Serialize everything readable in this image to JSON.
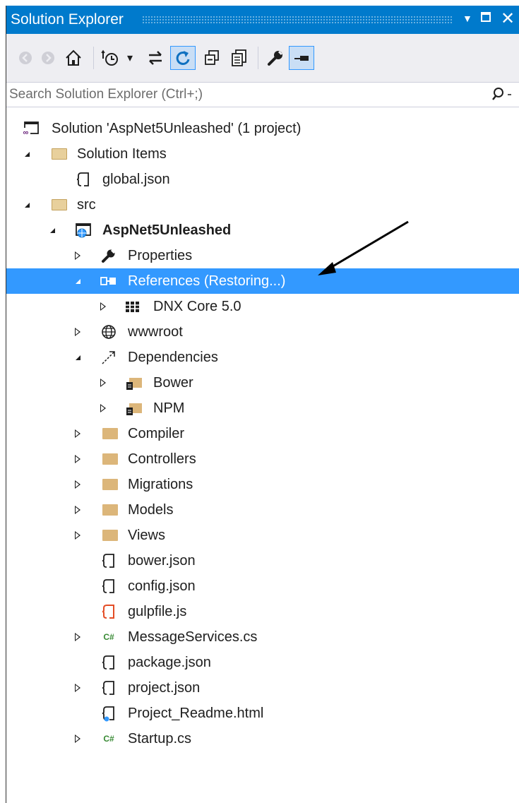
{
  "window": {
    "title": "Solution Explorer",
    "controls": {
      "dropdown": "▼",
      "close": "✕"
    }
  },
  "toolbar": {
    "buttons": [
      "back-icon",
      "forward-icon",
      "home-icon",
      "pending-changes-filter-icon",
      "sync-with-active-document-icon",
      "refresh-icon",
      "collapse-all-icon",
      "show-all-files-icon",
      "properties-icon",
      "preview-selected-items-icon"
    ],
    "dropdown_glyph": "▾"
  },
  "search": {
    "placeholder": "Search Solution Explorer (Ctrl+;)",
    "value": ""
  },
  "tree": {
    "items": [
      {
        "label": "Solution 'AspNet5Unleashed' (1 project)",
        "icon": "solution-icon",
        "expander": "none"
      },
      {
        "label": "Solution Items",
        "icon": "folder-icon",
        "expander": "expanded"
      },
      {
        "label": "global.json",
        "icon": "json-file-icon",
        "expander": "none"
      },
      {
        "label": "src",
        "icon": "folder-icon",
        "expander": "expanded"
      },
      {
        "label": "AspNet5Unleashed",
        "icon": "web-project-icon",
        "expander": "expanded"
      },
      {
        "label": "Properties",
        "icon": "wrench-icon",
        "expander": "collapsed"
      },
      {
        "label": "References (Restoring...)",
        "icon": "references-icon",
        "expander": "expanded"
      },
      {
        "label": "DNX Core 5.0",
        "icon": "framework-icon",
        "expander": "collapsed"
      },
      {
        "label": "wwwroot",
        "icon": "globe-icon",
        "expander": "collapsed"
      },
      {
        "label": "Dependencies",
        "icon": "dependencies-icon",
        "expander": "expanded"
      },
      {
        "label": "Bower",
        "icon": "package-folder-icon",
        "expander": "collapsed"
      },
      {
        "label": "NPM",
        "icon": "package-folder-icon",
        "expander": "collapsed"
      },
      {
        "label": "Compiler",
        "icon": "folder-icon",
        "expander": "collapsed"
      },
      {
        "label": "Controllers",
        "icon": "folder-icon",
        "expander": "collapsed"
      },
      {
        "label": "Migrations",
        "icon": "folder-icon",
        "expander": "collapsed"
      },
      {
        "label": "Models",
        "icon": "folder-icon",
        "expander": "collapsed"
      },
      {
        "label": "Views",
        "icon": "folder-icon",
        "expander": "collapsed"
      },
      {
        "label": "bower.json",
        "icon": "json-file-icon",
        "expander": "none"
      },
      {
        "label": "config.json",
        "icon": "json-file-icon",
        "expander": "none"
      },
      {
        "label": "gulpfile.js",
        "icon": "js-file-icon",
        "expander": "none"
      },
      {
        "label": "MessageServices.cs",
        "icon": "csharp-file-icon",
        "expander": "collapsed"
      },
      {
        "label": "package.json",
        "icon": "json-file-icon",
        "expander": "none"
      },
      {
        "label": "project.json",
        "icon": "json-file-icon",
        "expander": "collapsed"
      },
      {
        "label": "Project_Readme.html",
        "icon": "html-file-icon",
        "expander": "none"
      },
      {
        "label": "Startup.cs",
        "icon": "csharp-file-icon",
        "expander": "collapsed"
      }
    ],
    "selected_item": "References (Restoring...)"
  },
  "colors": {
    "title_bar": "#007acc",
    "selection": "#3399ff",
    "toolbar_background": "#eeeef2",
    "folder": "#dcb67a",
    "csharp": "#388a34",
    "js": "#e44d26"
  }
}
